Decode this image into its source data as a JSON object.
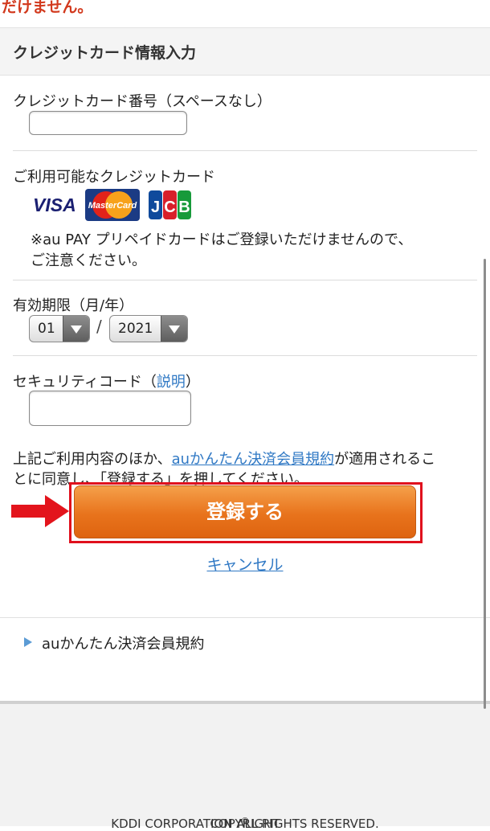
{
  "top_notice": "だけません。",
  "section_title": "クレジットカード情報入力",
  "card_number": {
    "label": "クレジットカード番号（スペースなし）",
    "value": "",
    "placeholder": ""
  },
  "available_cards": {
    "label": "ご利用可能なクレジットカード",
    "logos": [
      {
        "name": "visa-logo",
        "text": "VISA"
      },
      {
        "name": "mastercard-logo",
        "text": "MasterCard"
      },
      {
        "name": "jcb-logo",
        "text": "JCB"
      }
    ],
    "note_line1": "※au PAY プリペイドカードはご登録いただけませんので、",
    "note_line2": "ご注意ください。"
  },
  "expiry": {
    "label": "有効期限（月/年）",
    "month": "01",
    "separator": "/",
    "year": "2021"
  },
  "security_code": {
    "label_prefix": "セキュリティコード（",
    "link": "説明",
    "label_suffix": "）",
    "value": ""
  },
  "agreement": {
    "prefix": "上記ご利用内容のほか、",
    "link": "auかんたん決済会員規約",
    "suffix": "が適用されるこ",
    "line2": "とに同意し、「登録する」を押してください。"
  },
  "register_button": "登録する",
  "cancel_link": "キャンセル",
  "terms_row": "auかんたん決済会員規約",
  "footer_prefix": "COPYRIGHT",
  "footer_symbol": "©",
  "footer_suffix": "KDDI CORPORATION ALL RIGHTS RESERVED.",
  "colors": {
    "accent_orange": "#e8731c",
    "highlight_red": "#e0101d",
    "link_blue": "#2f78c4",
    "notice_red": "#d2391d"
  },
  "icons": [
    "red-arrow-icon",
    "select-caret-icon",
    "disclosure-triangle-icon"
  ]
}
